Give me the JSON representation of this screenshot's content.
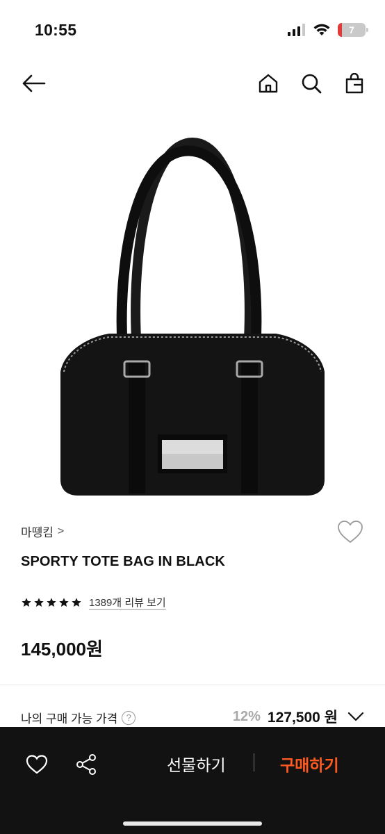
{
  "status_bar": {
    "time": "10:55",
    "battery_level": "7"
  },
  "nav": {
    "back_icon": "arrow-left-icon",
    "home_icon": "home-icon",
    "search_icon": "search-icon",
    "bag_icon": "shopping-bag-icon"
  },
  "product": {
    "brand": "마뗑킴",
    "brand_chevron": ">",
    "title": "SPORTY TOTE BAG IN BLACK",
    "rating_stars": 5,
    "review_link": "1389개 리뷰 보기",
    "price": "145,000원"
  },
  "my_price": {
    "label": "나의 구매 가능 가격",
    "help": "?",
    "discount": "12%",
    "final_price": "127,500 원"
  },
  "bottom_bar": {
    "gift_label": "선물하기",
    "buy_label": "구매하기",
    "buy_color": "#ff5a1f"
  }
}
